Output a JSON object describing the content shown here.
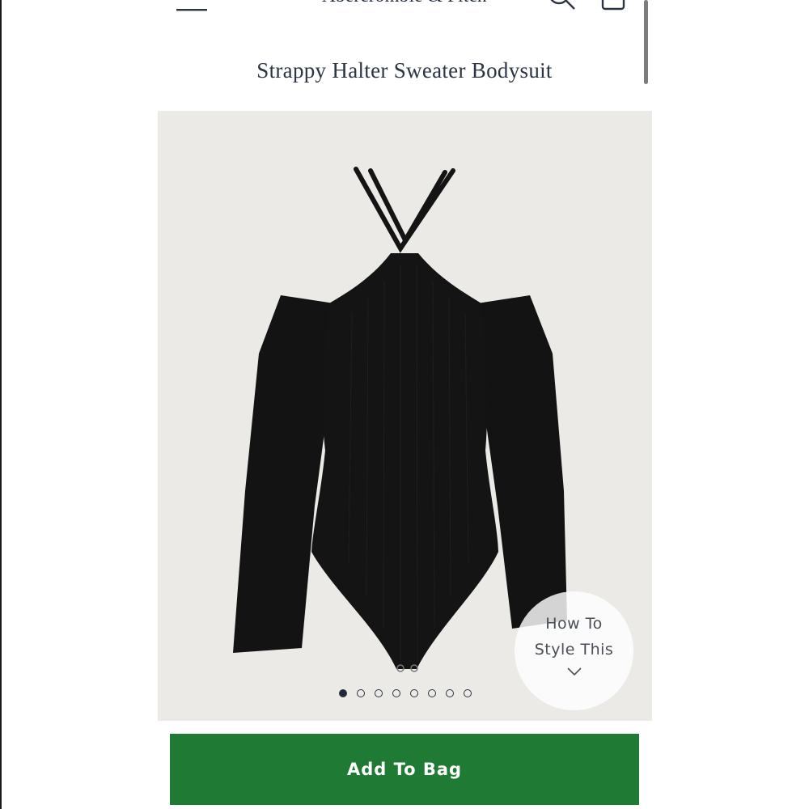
{
  "header": {
    "brand": "Abercrombie & Fitch",
    "menu_icon": "hamburger-menu-icon",
    "search_icon": "search-icon",
    "bag_icon": "shopping-bag-icon"
  },
  "product": {
    "title": "Strappy Halter Sweater Bodysuit",
    "image_description_icon": "product-photo",
    "gallery": {
      "total_images": 8,
      "active_index": 1
    },
    "how_to_style": {
      "line1": "How To",
      "line2": "Style This",
      "icon": "chevron-down-icon"
    }
  },
  "actions": {
    "add_to_bag": "Add To Bag"
  },
  "colors": {
    "brand_text": "#1d2a3a",
    "cta_green": "#1f7a34",
    "image_background": "#eceae6",
    "garment": "#121212"
  }
}
